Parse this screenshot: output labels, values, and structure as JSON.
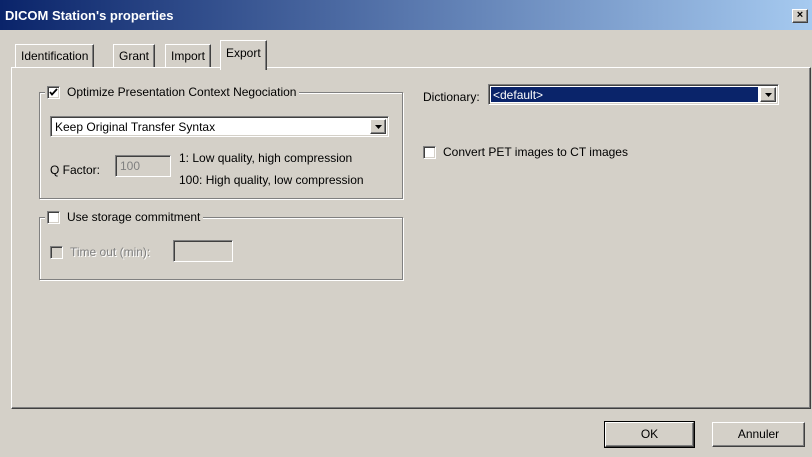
{
  "window": {
    "title": "DICOM Station's properties",
    "close_glyph": "×"
  },
  "tabs": [
    {
      "label": "Identification",
      "active": false
    },
    {
      "label": "Grant",
      "active": false
    },
    {
      "label": "Import",
      "active": false
    },
    {
      "label": "Export",
      "active": true
    }
  ],
  "optimize": {
    "label": "Optimize Presentation Context Negociation",
    "checked": true,
    "transfer_syntax": "Keep Original Transfer Syntax",
    "qfactor_label": "Q Factor:",
    "qfactor_value": "100",
    "hint_low": "1: Low quality, high compression",
    "hint_high": "100: High quality, low compression"
  },
  "storage": {
    "label": "Use storage commitment",
    "checked": false,
    "timeout_label": "Time out (min):",
    "timeout_value": ""
  },
  "dictionary": {
    "label": "Dictionary:",
    "value": "<default>"
  },
  "convert_pet": {
    "label": "Convert PET images to CT images",
    "checked": false
  },
  "buttons": {
    "ok": "OK",
    "cancel": "Annuler"
  }
}
